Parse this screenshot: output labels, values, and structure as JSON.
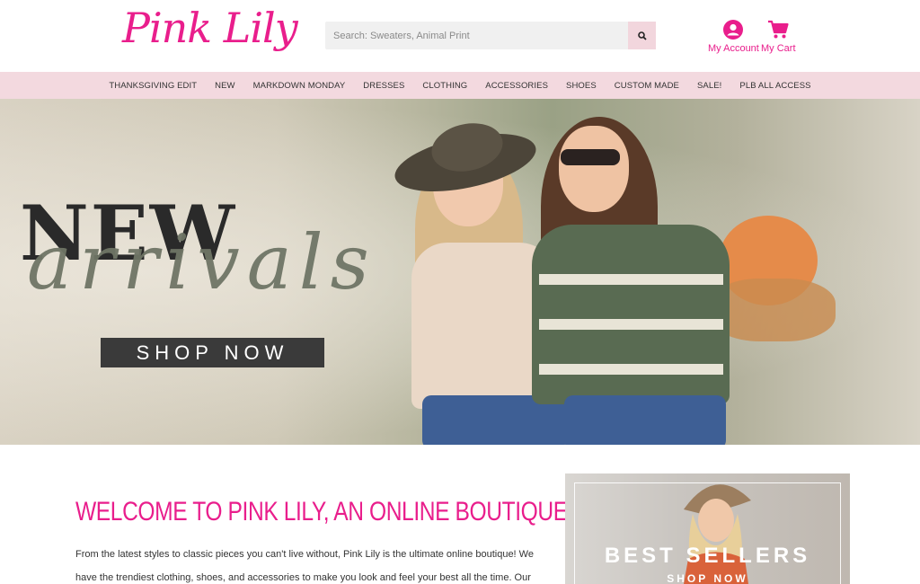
{
  "header": {
    "logo_text": "Pink Lily",
    "search_placeholder": "Search: Sweaters, Animal Print",
    "account_label": "My Account",
    "cart_label": "My Cart"
  },
  "nav": {
    "items": [
      "THANKSGIVING EDIT",
      "NEW",
      "MARKDOWN MONDAY",
      "DRESSES",
      "CLOTHING",
      "ACCESSORIES",
      "SHOES",
      "CUSTOM MADE",
      "SALE!",
      "PLB ALL ACCESS"
    ]
  },
  "hero": {
    "title_line1": "NEW",
    "title_line2": "arrivals",
    "cta_label": "SHOP NOW"
  },
  "main": {
    "welcome_heading": "WELCOME TO PINK LILY, AN ONLINE BOUTIQUE!",
    "paragraph": "From the latest styles to classic pieces you can't live without, Pink Lily is the ultimate online boutique! We have the trendiest clothing, shoes, and accessories to make you look and feel your best all the time. Our seasonal styles are"
  },
  "promo": {
    "title": "BEST SELLERS",
    "cta": "SHOP NOW"
  },
  "colors": {
    "brand_pink": "#e91e8c",
    "nav_bg": "#f3d9df"
  }
}
